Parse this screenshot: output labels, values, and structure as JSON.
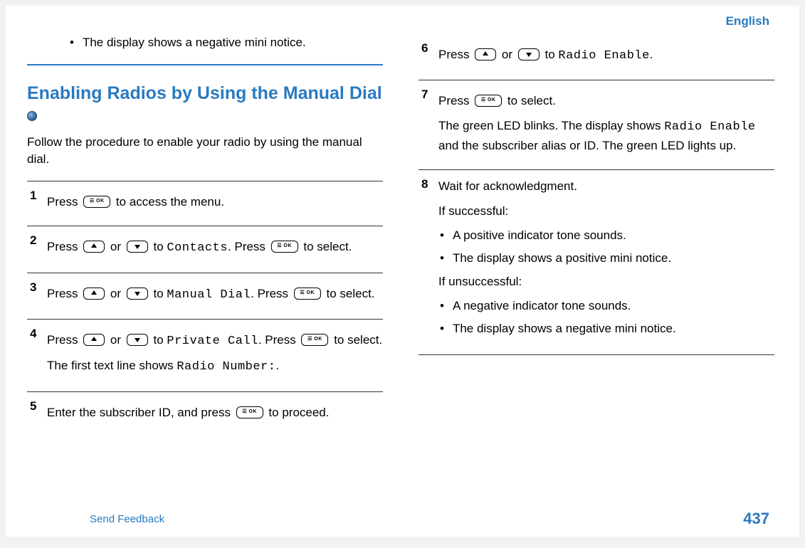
{
  "header": {
    "language": "English"
  },
  "prev_section_tail": {
    "bullet": "The display shows a negative mini notice."
  },
  "section": {
    "title": "Enabling Radios by Using the Manual Dial",
    "intro": "Follow the procedure to enable your radio by using the manual dial."
  },
  "steps": {
    "s1": {
      "num": "1",
      "t1": "Press ",
      "t2": " to access the menu."
    },
    "s2": {
      "num": "2",
      "t1": "Press ",
      "t2": " or ",
      "t3": " to ",
      "m1": "Contacts",
      "t4": ". Press ",
      "t5": " to select."
    },
    "s3": {
      "num": "3",
      "t1": "Press ",
      "t2": " or ",
      "t3": " to ",
      "m1": "Manual Dial",
      "t4": ". Press ",
      "t5": " to select."
    },
    "s4": {
      "num": "4",
      "t1": "Press ",
      "t2": " or ",
      "t3": " to ",
      "m1": "Private Call",
      "t4": ". Press ",
      "t5": " to select.",
      "extra_a": "The first text line shows ",
      "extra_m": "Radio Number:",
      "extra_b": "."
    },
    "s5": {
      "num": "5",
      "t1": "Enter the subscriber ID, and press ",
      "t2": " to proceed."
    },
    "s6": {
      "num": "6",
      "t1": "Press ",
      "t2": " or ",
      "t3": " to ",
      "m1": "Radio Enable",
      "t4": "."
    },
    "s7": {
      "num": "7",
      "t1": "Press ",
      "t2": " to select.",
      "extra_a": "The green LED blinks. The display shows ",
      "extra_m": "Radio Enable",
      "extra_b": " and the subscriber alias or ID. The green LED lights up."
    },
    "s8": {
      "num": "8",
      "line1": "Wait for acknowledgment.",
      "if_success": "If successful:",
      "s_b1": "A positive indicator tone sounds.",
      "s_b2": "The display shows a positive mini notice.",
      "if_fail": "If unsuccessful:",
      "f_b1": "A negative indicator tone sounds.",
      "f_b2": "The display shows a negative mini notice."
    }
  },
  "footer": {
    "feedback": "Send Feedback",
    "page": "437"
  }
}
